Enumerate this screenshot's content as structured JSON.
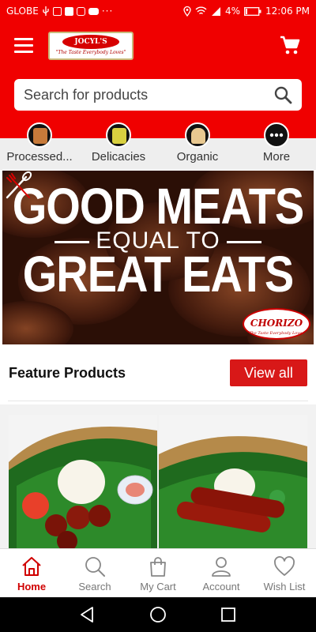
{
  "status_bar": {
    "carrier": "GLOBE",
    "battery": "4%",
    "time": "12:06 PM",
    "left_icons": [
      "usb-icon",
      "message-icon",
      "facebook-icon",
      "instagram-icon",
      "youtube-icon",
      "more-dots-icon"
    ],
    "right_icons": [
      "location-icon",
      "wifi-icon",
      "signal-icon",
      "battery-icon"
    ]
  },
  "header": {
    "brand_name": "JOCYL'S",
    "brand_tagline": "\"The Taste Everybody Loves\"",
    "accent_color": "#f00000"
  },
  "search": {
    "placeholder": "Search for products"
  },
  "categories": [
    {
      "label": "Processed...",
      "icon": "processed-food-icon"
    },
    {
      "label": "Delicacies",
      "icon": "delicacies-icon"
    },
    {
      "label": "Organic",
      "icon": "organic-icon"
    },
    {
      "label": "More",
      "icon": "more-icon"
    }
  ],
  "banner": {
    "line1": "GOOD MEATS",
    "line2": "EQUAL TO",
    "line3": "GREAT EATS",
    "badge_text": "CHORIZO",
    "badge_tagline": "\"The Taste Everybody Loves\""
  },
  "featured": {
    "title": "Feature Products",
    "view_all_label": "View all",
    "button_color": "#d81818"
  },
  "bottom_nav": [
    {
      "label": "Home",
      "icon": "home-icon",
      "active": true
    },
    {
      "label": "Search",
      "icon": "search-icon",
      "active": false
    },
    {
      "label": "My Cart",
      "icon": "shopping-bag-icon",
      "active": false
    },
    {
      "label": "Account",
      "icon": "account-icon",
      "active": false
    },
    {
      "label": "Wish List",
      "icon": "heart-icon",
      "active": false
    }
  ],
  "system_nav": [
    "back-icon",
    "home-circle-icon",
    "recents-icon"
  ]
}
